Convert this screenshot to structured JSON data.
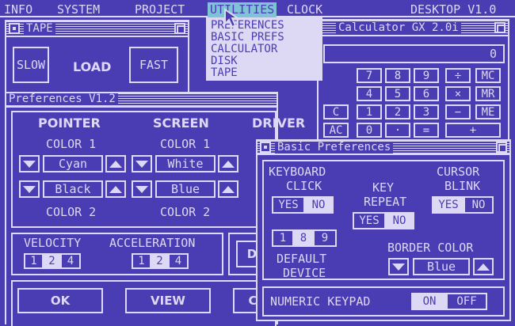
{
  "menubar": {
    "items": [
      "INFO",
      "SYSTEM",
      "PROJECT",
      "UTILITIES",
      "CLOCK"
    ],
    "right_title": "DESKTOP V1.0"
  },
  "utilities_menu": [
    "PREFERENCES",
    "BASIC PREFS",
    "CALCULATOR",
    "DISK",
    "TAPE"
  ],
  "tape_window": {
    "title": "TAPE",
    "slow": "SLOW",
    "load": "LOAD",
    "fast": "FAST"
  },
  "calc_window": {
    "title": "Calculator GX 2.0i",
    "display": "0",
    "keys": [
      [
        "7",
        "8",
        "9",
        "÷",
        "MC"
      ],
      [
        "4",
        "5",
        "6",
        "×",
        "MR"
      ],
      [
        "C",
        "1",
        "2",
        "3",
        "−",
        "ME"
      ],
      [
        "AC",
        "0",
        "·",
        "=",
        "+"
      ]
    ]
  },
  "prefs_window": {
    "title": "Preferences V1.2",
    "pointer_label": "POINTER",
    "screen_label": "SCREEN",
    "driver_label": "DRIVER",
    "color1": "COLOR 1",
    "color2": "COLOR 2",
    "pointer_color1": "Cyan",
    "pointer_color2": "Black",
    "screen_color1": "White",
    "screen_color2": "Blue",
    "velocity_label": "VELOCITY",
    "acceleration_label": "ACCELERATION",
    "velocity_options": [
      "1",
      "2",
      "4"
    ],
    "velocity_selected": "2",
    "acceleration_options": [
      "1",
      "2",
      "4"
    ],
    "acceleration_selected": "2",
    "partial_button": "D",
    "ok": "OK",
    "view": "VIEW",
    "partial_bottom": "C"
  },
  "basic_prefs_window": {
    "title": "Basic Preferences",
    "keyboard_click_label_1": "KEYBOARD",
    "keyboard_click_label_2": "CLICK",
    "key_repeat_label_1": "KEY",
    "key_repeat_label_2": "REPEAT",
    "cursor_blink_label_1": "CURSOR",
    "cursor_blink_label_2": "BLINK",
    "yes": "YES",
    "no": "NO",
    "keyboard_click_value": "NO",
    "key_repeat_value": "NO",
    "cursor_blink_value": "YES",
    "device_options": [
      "1",
      "8",
      "9"
    ],
    "device_selected": "8",
    "default_device_label_1": "DEFAULT",
    "default_device_label_2": "DEVICE",
    "border_color_label": "BORDER COLOR",
    "border_color_value": "Blue",
    "numeric_keypad_label": "NUMERIC KEYPAD",
    "on": "ON",
    "off": "OFF",
    "numeric_keypad_value": "ON"
  },
  "colors": {
    "background": "#4a3cb2",
    "foreground": "#ddd8f4",
    "menu_highlight": "#7fc4d6"
  }
}
